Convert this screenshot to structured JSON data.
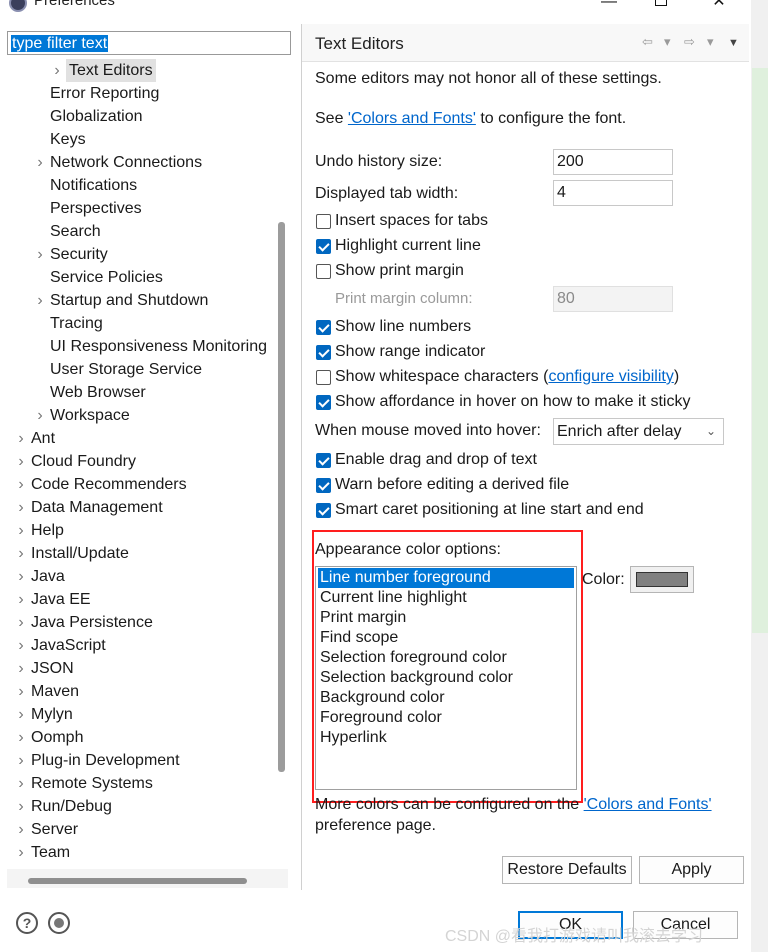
{
  "window": {
    "title": "Preferences",
    "controls": {
      "minimize": "—",
      "maximize": "",
      "close": "✕"
    }
  },
  "filter": {
    "value": "type filter text"
  },
  "tree": {
    "items": [
      {
        "label": "Text Editors",
        "level": 2,
        "expandable": true,
        "selected": true
      },
      {
        "label": "Error Reporting",
        "level": 1,
        "expandable": false
      },
      {
        "label": "Globalization",
        "level": 1,
        "expandable": false
      },
      {
        "label": "Keys",
        "level": 1,
        "expandable": false
      },
      {
        "label": "Network Connections",
        "level": 1,
        "expandable": true
      },
      {
        "label": "Notifications",
        "level": 1,
        "expandable": false
      },
      {
        "label": "Perspectives",
        "level": 1,
        "expandable": false
      },
      {
        "label": "Search",
        "level": 1,
        "expandable": false
      },
      {
        "label": "Security",
        "level": 1,
        "expandable": true
      },
      {
        "label": "Service Policies",
        "level": 1,
        "expandable": false
      },
      {
        "label": "Startup and Shutdown",
        "level": 1,
        "expandable": true
      },
      {
        "label": "Tracing",
        "level": 1,
        "expandable": false
      },
      {
        "label": "UI Responsiveness Monitoring",
        "level": 1,
        "expandable": false
      },
      {
        "label": "User Storage Service",
        "level": 1,
        "expandable": false
      },
      {
        "label": "Web Browser",
        "level": 1,
        "expandable": false
      },
      {
        "label": "Workspace",
        "level": 1,
        "expandable": true
      },
      {
        "label": "Ant",
        "level": 0,
        "expandable": true
      },
      {
        "label": "Cloud Foundry",
        "level": 0,
        "expandable": true
      },
      {
        "label": "Code Recommenders",
        "level": 0,
        "expandable": true
      },
      {
        "label": "Data Management",
        "level": 0,
        "expandable": true
      },
      {
        "label": "Help",
        "level": 0,
        "expandable": true
      },
      {
        "label": "Install/Update",
        "level": 0,
        "expandable": true
      },
      {
        "label": "Java",
        "level": 0,
        "expandable": true
      },
      {
        "label": "Java EE",
        "level": 0,
        "expandable": true
      },
      {
        "label": "Java Persistence",
        "level": 0,
        "expandable": true
      },
      {
        "label": "JavaScript",
        "level": 0,
        "expandable": true
      },
      {
        "label": "JSON",
        "level": 0,
        "expandable": true
      },
      {
        "label": "Maven",
        "level": 0,
        "expandable": true
      },
      {
        "label": "Mylyn",
        "level": 0,
        "expandable": true
      },
      {
        "label": "Oomph",
        "level": 0,
        "expandable": true
      },
      {
        "label": "Plug-in Development",
        "level": 0,
        "expandable": true
      },
      {
        "label": "Remote Systems",
        "level": 0,
        "expandable": true
      },
      {
        "label": "Run/Debug",
        "level": 0,
        "expandable": true
      },
      {
        "label": "Server",
        "level": 0,
        "expandable": true
      },
      {
        "label": "Team",
        "level": 0,
        "expandable": true
      }
    ]
  },
  "panel": {
    "title": "Text Editors",
    "nav": {
      "back": "⇦",
      "back_menu": "▾",
      "forward": "⇨",
      "forward_menu": "▾",
      "menu": "▼"
    },
    "note": "Some editors may not honor all of these settings.",
    "see_prefix": "See ",
    "see_link": "'Colors and Fonts'",
    "see_suffix": " to configure the font.",
    "undo_label": "Undo history size:",
    "undo_value": "200",
    "tab_label": "Displayed tab width:",
    "tab_value": "4",
    "insert_spaces": "Insert spaces for tabs",
    "highlight_line": "Highlight current line",
    "print_margin": "Show print margin",
    "print_margin_col_label": "Print margin column:",
    "print_margin_col_value": "80",
    "line_numbers": "Show line numbers",
    "range_indicator": "Show range indicator",
    "whitespace_prefix": "Show whitespace characters (",
    "whitespace_link": "configure visibility",
    "whitespace_suffix": ")",
    "affordance": "Show affordance in hover on how to make it sticky",
    "hover_label": "When mouse moved into hover:",
    "hover_value": "Enrich after delay",
    "drag_drop": "Enable drag and drop of text",
    "warn_derived": "Warn before editing a derived file",
    "smart_caret": "Smart caret positioning at line start and end",
    "appearance_label": "Appearance color options:",
    "appearance_items": [
      "Line number foreground",
      "Current line highlight",
      "Print margin",
      "Find scope",
      "Selection foreground color",
      "Selection background color",
      "Background color",
      "Foreground color",
      "Hyperlink"
    ],
    "color_label": "Color:",
    "more_colors_prefix": "More colors can be configured on the ",
    "more_colors_link": "'Colors and Fonts'",
    "more_colors_suffix": "preference page.",
    "restore_defaults": "Restore Defaults",
    "apply": "Apply"
  },
  "checks": {
    "insert_spaces": false,
    "highlight_line": true,
    "print_margin": false,
    "line_numbers": true,
    "range_indicator": true,
    "whitespace": false,
    "affordance": true,
    "drag_drop": true,
    "warn_derived": true,
    "smart_caret": true
  },
  "footer": {
    "help_icon": "?",
    "ok": "OK",
    "cancel": "Cancel"
  },
  "watermark": "CSDN @看我打游戏请叫我滚去学习",
  "colors": {
    "accent": "#0078d7",
    "highlight_box": "#ff1e1e",
    "swatch": "#808080",
    "link": "#0066cc"
  }
}
